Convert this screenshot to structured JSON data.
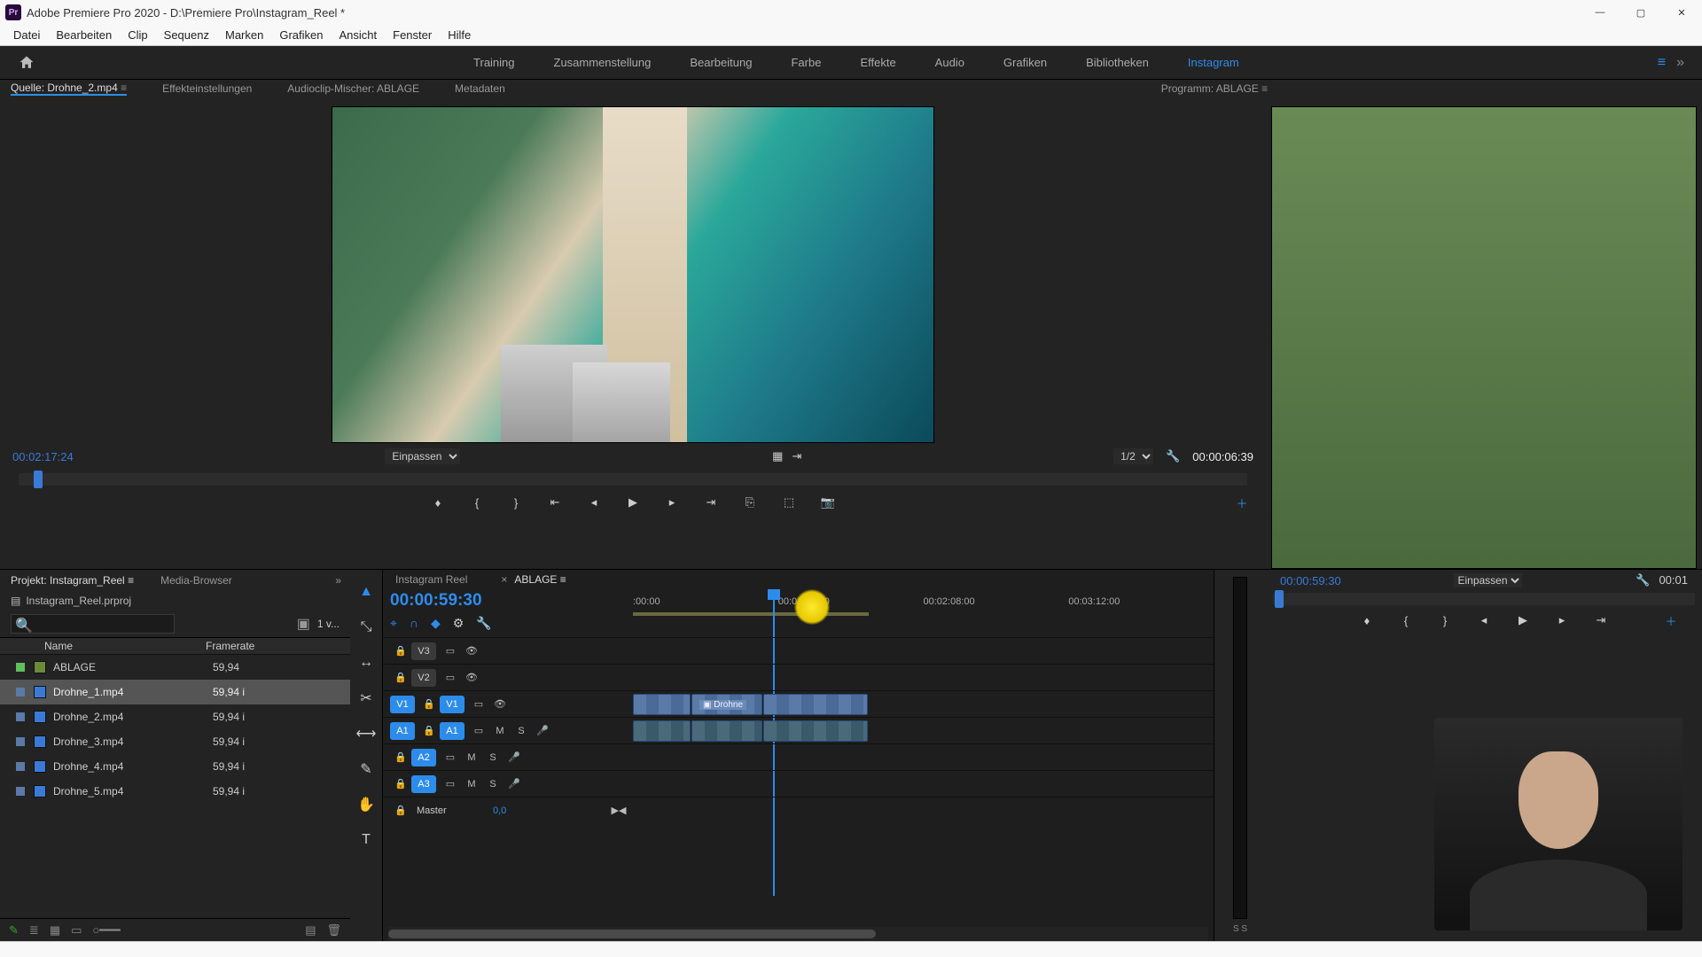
{
  "titlebar": {
    "title": "Adobe Premiere Pro 2020 - D:\\Premiere Pro\\Instagram_Reel *"
  },
  "menubar": [
    "Datei",
    "Bearbeiten",
    "Clip",
    "Sequenz",
    "Marken",
    "Grafiken",
    "Ansicht",
    "Fenster",
    "Hilfe"
  ],
  "workspaces": {
    "items": [
      "Training",
      "Zusammenstellung",
      "Bearbeitung",
      "Farbe",
      "Effekte",
      "Audio",
      "Grafiken",
      "Bibliotheken",
      "Instagram"
    ],
    "active": "Instagram"
  },
  "source_tabs": {
    "items": [
      "Quelle: Drohne_2.mp4",
      "Effekteinstellungen",
      "Audioclip-Mischer: ABLAGE",
      "Metadaten"
    ],
    "active": 0
  },
  "program_tab": "Programm: ABLAGE",
  "source": {
    "timecode": "00:02:17:24",
    "fit": "Einpassen",
    "zoom_ratio": "1/2",
    "duration": "00:00:06:39"
  },
  "program": {
    "timecode": "00:00:59:30",
    "fit": "Einpassen",
    "duration": "00:01"
  },
  "project": {
    "tabs": [
      "Projekt: Instagram_Reel",
      "Media-Browser"
    ],
    "file": "Instagram_Reel.prproj",
    "filter": "1 v...",
    "columns": {
      "name": "Name",
      "framerate": "Framerate"
    },
    "rows": [
      {
        "name": "ABLAGE",
        "rate": "59,94",
        "type": "seq",
        "color": "#5fbf5f",
        "sel": false
      },
      {
        "name": "Drohne_1.mp4",
        "rate": "59,94 i",
        "type": "clip",
        "color": "#5a7aa8",
        "sel": true
      },
      {
        "name": "Drohne_2.mp4",
        "rate": "59,94 i",
        "type": "clip",
        "color": "#5a7aa8",
        "sel": false
      },
      {
        "name": "Drohne_3.mp4",
        "rate": "59,94 i",
        "type": "clip",
        "color": "#5a7aa8",
        "sel": false
      },
      {
        "name": "Drohne_4.mp4",
        "rate": "59,94 i",
        "type": "clip",
        "color": "#5a7aa8",
        "sel": false
      },
      {
        "name": "Drohne_5.mp4",
        "rate": "59,94 i",
        "type": "clip",
        "color": "#5a7aa8",
        "sel": false
      }
    ]
  },
  "timeline": {
    "tabs": [
      "Instagram Reel",
      "ABLAGE"
    ],
    "active": 1,
    "timecode": "00:00:59:30",
    "ruler": [
      ":00:00",
      "00:01:04:00",
      "00:02:08:00",
      "00:03:12:00"
    ],
    "tracks": {
      "v": [
        "V3",
        "V2",
        "V1"
      ],
      "a": [
        "A1",
        "A2",
        "A3"
      ],
      "master": "Master",
      "master_val": "0,0"
    },
    "clip_label": "Drohne"
  },
  "audio_meter_label": "S S"
}
